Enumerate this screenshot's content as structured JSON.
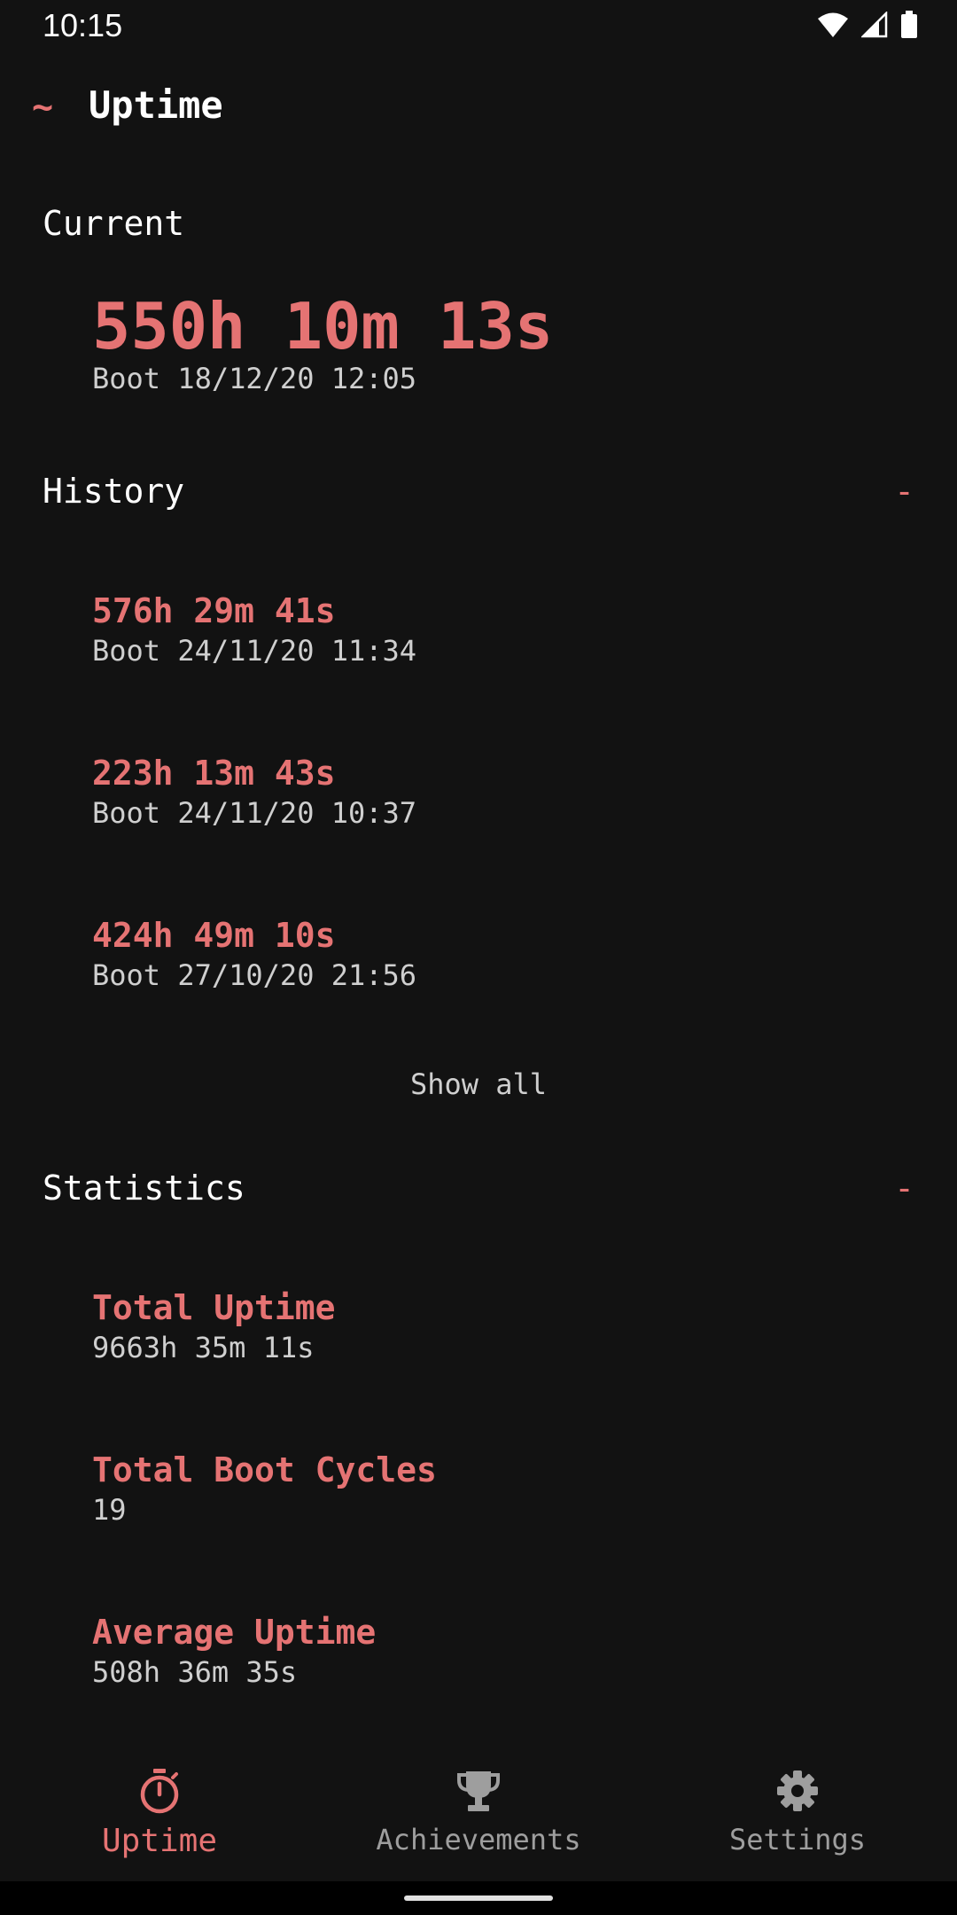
{
  "status_bar": {
    "time": "10:15"
  },
  "app_bar": {
    "icon_text": "~",
    "title": "Uptime"
  },
  "current": {
    "header": "Current",
    "value": "550h 10m 13s",
    "boot": "Boot 18/12/20 12:05"
  },
  "history": {
    "header": "History",
    "collapse_label": "-",
    "items": [
      {
        "duration": "576h 29m 41s",
        "boot": "Boot 24/11/20 11:34"
      },
      {
        "duration": "223h 13m 43s",
        "boot": "Boot 24/11/20 10:37"
      },
      {
        "duration": "424h 49m 10s",
        "boot": "Boot 27/10/20 21:56"
      }
    ],
    "show_all": "Show all"
  },
  "statistics": {
    "header": "Statistics",
    "collapse_label": "-",
    "items": [
      {
        "label": "Total Uptime",
        "value": "9663h 35m 11s"
      },
      {
        "label": "Total Boot Cycles",
        "value": "19"
      },
      {
        "label": "Average Uptime",
        "value": "508h 36m 35s"
      }
    ]
  },
  "bottom_nav": {
    "items": [
      {
        "label": "Uptime",
        "icon": "stopwatch-icon",
        "active": true
      },
      {
        "label": "Achievements",
        "icon": "trophy-icon",
        "active": false
      },
      {
        "label": "Settings",
        "icon": "gear-icon",
        "active": false
      }
    ]
  },
  "colors": {
    "background": "#121212",
    "accent": "#e57373",
    "secondary_text": "#cfcfcf",
    "inactive_nav": "#9e9e9e"
  }
}
